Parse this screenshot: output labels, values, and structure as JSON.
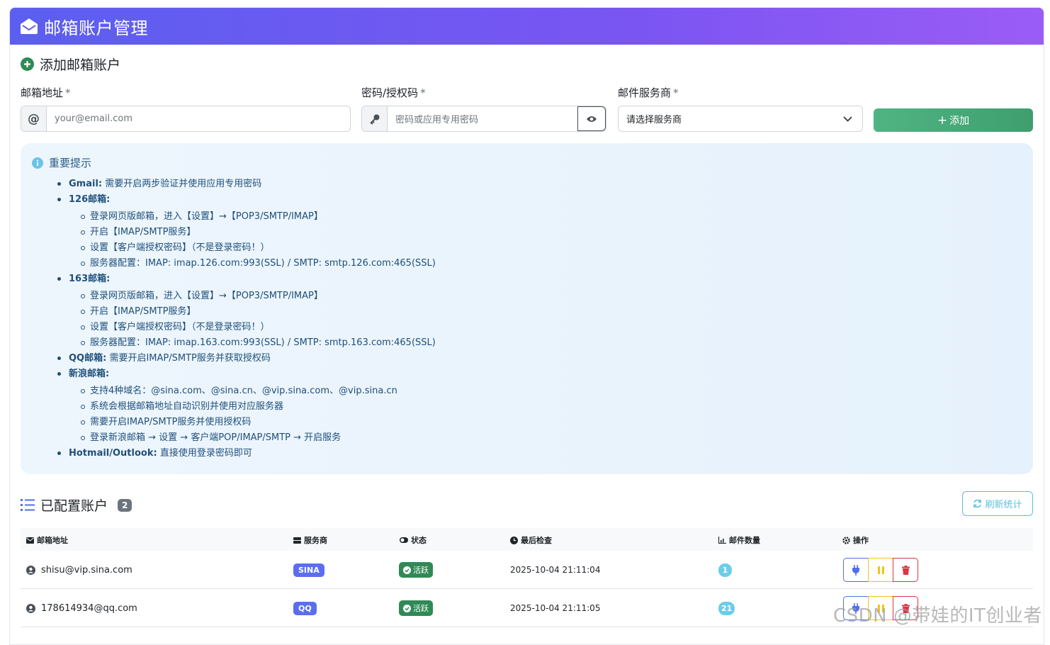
{
  "header": {
    "title": "邮箱账户管理"
  },
  "add_section": {
    "title": "添加邮箱账户",
    "email_label": "邮箱地址",
    "password_label": "密码/授权码",
    "provider_label": "邮件服务商",
    "required_mark": "*",
    "email_placeholder": "your@email.com",
    "password_placeholder": "密码或应用专用密码",
    "provider_selected": "请选择服务商",
    "add_button": "添加"
  },
  "tips": {
    "title": "重要提示",
    "gmail_name": "Gmail:",
    "gmail_text": "需要开启两步验证并使用应用专用密码",
    "m126_name": "126邮箱:",
    "m126_items": [
      "登录网页版邮箱，进入【设置】→【POP3/SMTP/IMAP】",
      "开启【IMAP/SMTP服务】",
      "设置【客户端授权密码】（不是登录密码！）",
      "服务器配置：IMAP: imap.126.com:993(SSL) / SMTP: smtp.126.com:465(SSL)"
    ],
    "m163_name": "163邮箱:",
    "m163_items": [
      "登录网页版邮箱，进入【设置】→【POP3/SMTP/IMAP】",
      "开启【IMAP/SMTP服务】",
      "设置【客户端授权密码】（不是登录密码！）",
      "服务器配置：IMAP: imap.163.com:993(SSL) / SMTP: smtp.163.com:465(SSL)"
    ],
    "qq_name": "QQ邮箱:",
    "qq_text": "需要开启IMAP/SMTP服务并获取授权码",
    "sina_name": "新浪邮箱:",
    "sina_items": [
      "支持4种域名：@sina.com、@sina.cn、@vip.sina.com、@vip.sina.cn",
      "系统会根据邮箱地址自动识别并使用对应服务器",
      "需要开启IMAP/SMTP服务并使用授权码",
      "登录新浪邮箱 → 设置 → 客户端POP/IMAP/SMTP → 开启服务"
    ],
    "hotmail_name": "Hotmail/Outlook:",
    "hotmail_text": "直接使用登录密码即可"
  },
  "accounts": {
    "title": "已配置账户",
    "count": "2",
    "refresh_button": "刷新统计",
    "columns": [
      "邮箱地址",
      "服务商",
      "状态",
      "最后检查",
      "邮件数量",
      "操作"
    ],
    "rows": [
      {
        "email": "shisu@vip.sina.com",
        "provider": "SINA",
        "status": "活跃",
        "last_check": "2025-10-04 21:11:04",
        "mail_count": "1"
      },
      {
        "email": "178614934@qq.com",
        "provider": "QQ",
        "status": "活跃",
        "last_check": "2025-10-04 21:11:05",
        "mail_count": "21"
      }
    ]
  },
  "watermark": "CSDN @带娃的IT创业者",
  "colors": {
    "header_start": "#5b5ff0",
    "header_end": "#9b5cf6",
    "success": "#3f9e6e",
    "info": "#5bc0de",
    "danger": "#dc3545",
    "warning": "#f0c419",
    "primary": "#4f6ef0"
  }
}
